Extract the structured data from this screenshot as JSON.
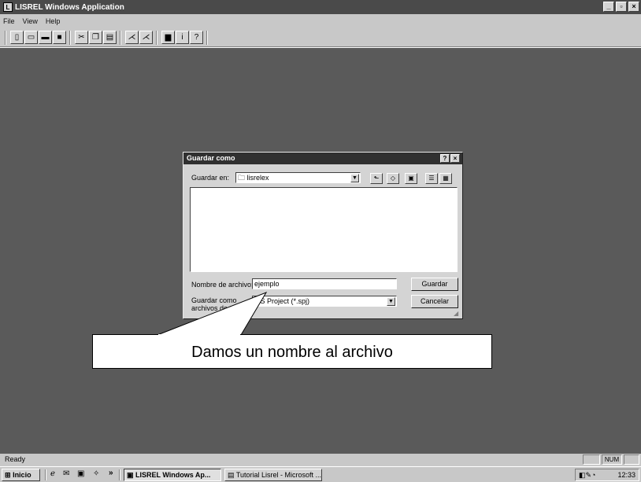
{
  "window": {
    "title": "LISREL Windows Application"
  },
  "menu": [
    "File",
    "View",
    "Help"
  ],
  "toolbar_icons": [
    "new-icon",
    "open-icon",
    "open-folder-icon",
    "save-icon",
    "cut-icon",
    "copy-icon",
    "paste-icon",
    "path-diagram-icon",
    "path-diagram-2-icon",
    "print-icon",
    "info-icon",
    "help-icon"
  ],
  "dialog": {
    "title": "Guardar como",
    "save_in_label": "Guardar en:",
    "save_in_value": "lisrelex",
    "filename_label": "Nombre de archivo:",
    "filename_value": "ejemplo",
    "filetype_label_1": "Guardar como",
    "filetype_label_2": "archivos de tipo:",
    "filetype_value": "LIS Project (*.spj)",
    "save_button": "Guardar",
    "cancel_button": "Cancelar"
  },
  "callout": "Damos un nombre al archivo",
  "statusbar": {
    "text": "Ready",
    "num": "NUM"
  },
  "taskbar": {
    "start": "Inicio",
    "task1": "LISREL Windows Ap...",
    "task2": "Tutorial Lisrel - Microsoft ...",
    "clock": "12:33"
  }
}
